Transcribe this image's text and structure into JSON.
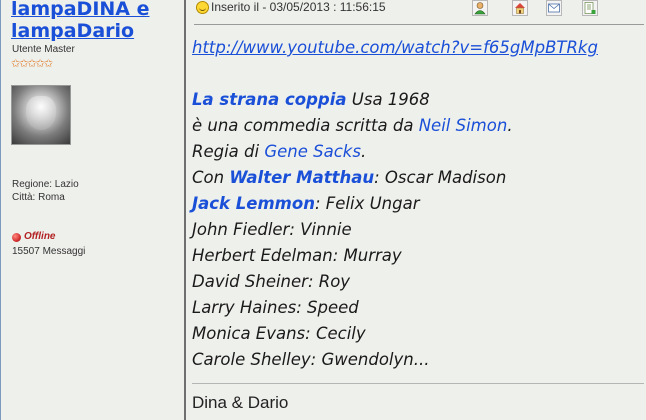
{
  "author": {
    "name": "lampaDINA e lampaDario",
    "rank": "Utente Master",
    "stars": "✩✩✩✩✩",
    "region": "Regione: Lazio",
    "city": "Città: Roma",
    "status": "Offline",
    "messages": "15507 Messaggi"
  },
  "post": {
    "header": "Inserito il - 03/05/2013 :  11:56:15",
    "link": "http://www.youtube.com/watch?v=f65gMpBTRkg",
    "line1_title": "La strana coppia",
    "line1_rest": " Usa 1968",
    "line2_pre": "è una commedia scritta da ",
    "line2_name": "Neil Simon",
    "line2_post": ".",
    "line3_pre": "Regia di ",
    "line3_name": "Gene Sacks",
    "line3_post": ".",
    "line4_pre": "Con ",
    "line4_name": "Walter Matthau",
    "line4_post": ": Oscar Madison",
    "line5_name": "Jack Lemmon",
    "line5_post": ": Felix Ungar",
    "cast": [
      "John Fiedler: Vinnie",
      "Herbert Edelman: Murray",
      "David Sheiner: Roy",
      "Larry Haines: Speed",
      "Monica Evans: Cecily",
      "Carole Shelley: Gwendolyn..."
    ],
    "signature": "Dina & Dario"
  },
  "colors": {
    "link": "#1a4fd8",
    "background": "#eef0ec",
    "offline": "#b22222"
  },
  "icons": [
    "profile-icon",
    "home-icon",
    "email-icon",
    "quote-icon"
  ]
}
